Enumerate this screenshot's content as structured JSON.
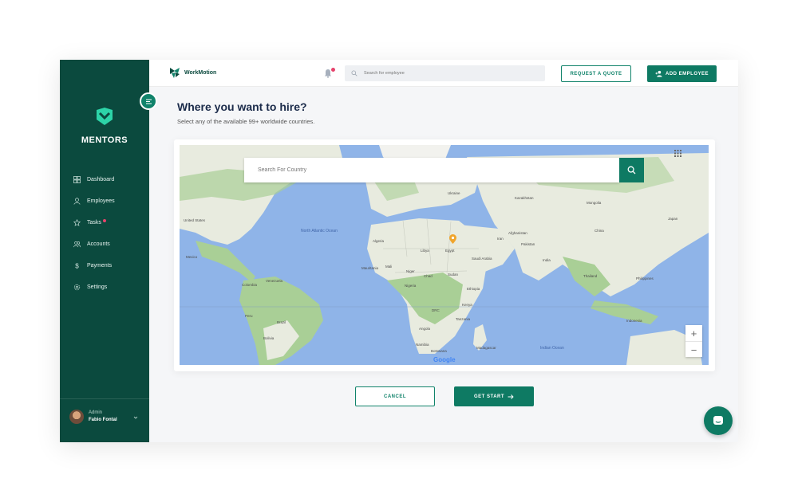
{
  "brand": {
    "name": "MENTORS"
  },
  "topbar": {
    "logo_text": "WorkMotion",
    "search_placeholder": "Search for employee",
    "request_quote_label": "REQUEST A QUOTE",
    "add_employee_label": "ADD EMPLOYEE"
  },
  "sidebar": {
    "items": [
      {
        "label": "Dashboard",
        "icon": "dashboard-icon"
      },
      {
        "label": "Employees",
        "icon": "user-icon"
      },
      {
        "label": "Tasks",
        "icon": "star-icon",
        "badge_dot": true
      },
      {
        "label": "Accounts",
        "icon": "users-icon"
      },
      {
        "label": "Payments",
        "icon": "dollar-icon"
      },
      {
        "label": "Settings",
        "icon": "gear-icon"
      }
    ],
    "admin": {
      "role": "Admin",
      "name": "Fabio Fontal"
    }
  },
  "main": {
    "title": "Where you want to hire?",
    "subtitle": "Select any of the available 99+ worldwide countries.",
    "map": {
      "search_placeholder": "Search For Country",
      "attribution": "Google",
      "labels": {
        "north_atlantic": "North Atlantic Ocean",
        "indian_ocean": "Indian Ocean",
        "united_states": "United States",
        "mexico": "Mexico",
        "egypt": "Egypt",
        "libya": "Libya",
        "algeria": "Algeria",
        "mali": "Mali",
        "niger": "Niger",
        "chad": "Chad",
        "sudan": "Sudan",
        "saudi_arabia": "Saudi Arabia",
        "iran": "Iran",
        "india": "India",
        "china": "China",
        "mongolia": "Mongolia",
        "kazakhstan": "Kazakhstan",
        "ukraine": "Ukraine",
        "drc": "DRC",
        "tanzania": "Tanzania",
        "angola": "Angola",
        "peru": "Peru",
        "brazil": "Brazil",
        "bolivia": "Bolivia",
        "colombia": "Colombia",
        "kenya": "Kenya",
        "ethiopia": "Ethiopia",
        "nigeria": "Nigeria",
        "mauritania": "Mauritania",
        "pakistan": "Pakistan",
        "afghanistan": "Afghanistan",
        "japan": "Japan",
        "philippines": "Philippines",
        "thailand": "Thailand",
        "indonesia": "Indonesia",
        "venezuela": "Venezuela",
        "namibia": "Namibia",
        "botswana": "Botswana",
        "madagascar": "Madagascar"
      }
    },
    "cancel_label": "CANCEL",
    "get_start_label": "GET START"
  },
  "colors": {
    "sidebar": "#0b4a3e",
    "accent": "#0e7a63",
    "water": "#8fb4e8",
    "land": "#e8ebdf",
    "forest": "#a9cf96"
  }
}
